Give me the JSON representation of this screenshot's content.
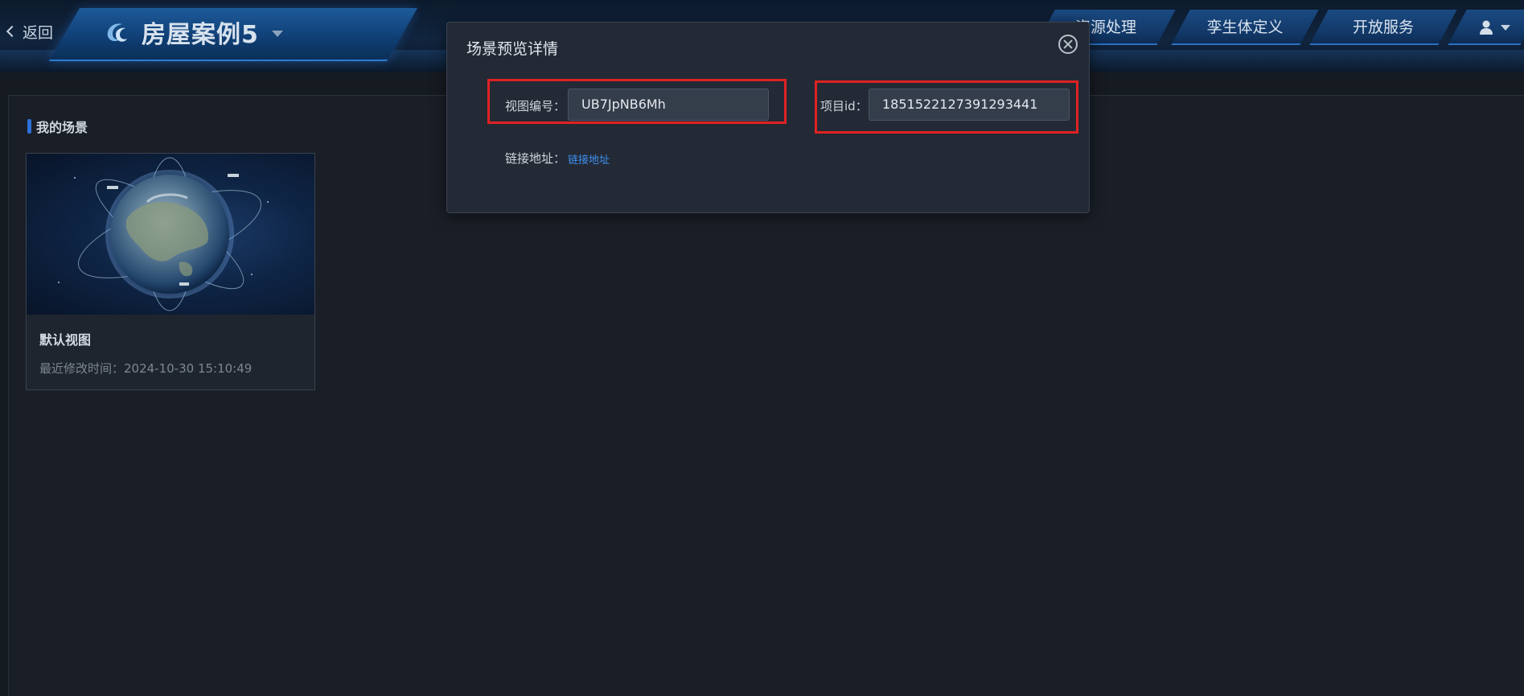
{
  "header": {
    "back_label": "返回",
    "project_title": "房屋案例5",
    "tabs": [
      {
        "label": "资源处理"
      },
      {
        "label": "孪生体定义"
      },
      {
        "label": "开放服务"
      }
    ]
  },
  "main": {
    "section_title": "我的场景",
    "cards": [
      {
        "title": "默认视图",
        "modified": "最近修改时间：2024-10-30 15:10:49"
      }
    ]
  },
  "modal": {
    "title": "场景预览详情",
    "view_id_label": "视图编号：",
    "view_id_value": "UB7JpNB6Mh",
    "project_id_label": "项目id：",
    "project_id_value": "1851522127391293441",
    "link_label": "链接地址：",
    "link_text": "链接地址"
  },
  "colors": {
    "accent": "#2f6fd8",
    "highlight": "#e02222",
    "link": "#3d8ff0"
  },
  "icons": [
    "chevron-left-icon",
    "logo-icon",
    "caret-down-icon",
    "user-icon",
    "close-circle-icon"
  ]
}
